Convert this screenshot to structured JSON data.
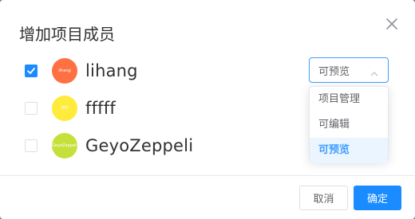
{
  "dialog": {
    "title": "增加项目成员",
    "close_icon": "close-icon"
  },
  "members": [
    {
      "name": "lihang",
      "avatar_text": "lihang",
      "avatar_color": "#ff7043",
      "checked": true
    },
    {
      "name": "fffff",
      "avatar_text": "fffff",
      "avatar_color": "#ffeb3b",
      "checked": false
    },
    {
      "name": "GeyoZeppeli",
      "avatar_text": "GeyoZeppeli",
      "avatar_color": "#c6e03a",
      "checked": false
    }
  ],
  "role_select": {
    "value": "可预览",
    "options": [
      "项目管理",
      "可编辑",
      "可预览"
    ],
    "selected_option": "可预览"
  },
  "footer": {
    "cancel_label": "取消",
    "confirm_label": "确定"
  },
  "colors": {
    "primary": "#1a8cff",
    "select_border": "#409eff"
  }
}
